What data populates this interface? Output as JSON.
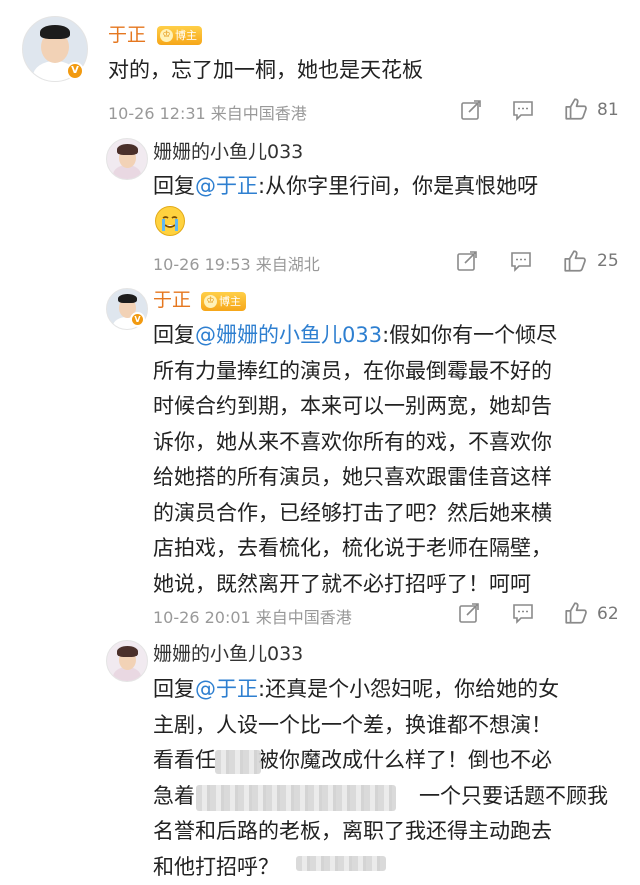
{
  "comments": [
    {
      "user": "于正",
      "badge": "博主",
      "lines": [
        "对的，忘了加一桐，她也是天花板"
      ],
      "meta": "10-26 12:31 来自中国香港",
      "likes": "81"
    },
    {
      "user": "姗姗的小鱼儿033",
      "reply_prefix": "回复",
      "mention": "@于正",
      "line1_rest": ":从你字里行间，你是真恨她呀",
      "meta": "10-26 19:53 来自湖北",
      "likes": "25"
    },
    {
      "user": "于正",
      "badge": "博主",
      "reply_prefix": "回复",
      "mention": "@姗姗的小鱼儿033",
      "line1_rest": ":假如你有一个倾尽",
      "lines": [
        "所有力量捧红的演员，在你最倒霉最不好的",
        "时候合约到期，本来可以一别两宽，她却告",
        "诉你，她从来不喜欢你所有的戏，不喜欢你",
        "给她搭的所有演员，她只喜欢跟雷佳音这样",
        "的演员合作，已经够打击了吧？然后她来横",
        "店拍戏，去看梳化，梳化说于老师在隔壁，",
        "她说，既然离开了就不必打招呼了！呵呵"
      ],
      "meta": "10-26 20:01 来自中国香港",
      "likes": "62"
    },
    {
      "user": "姗姗的小鱼儿033",
      "reply_prefix": "回复",
      "mention": "@于正",
      "line1_rest": ":还真是个小怨妇呢，你给她的女",
      "lines": [
        "主剧，人设一个比一个差，换谁都不想演！",
        "看看任",
        "急着",
        "名誉和后路的老板，离职了我还得主动跑去",
        "和他打招呼？"
      ],
      "fragments": {
        "line3_tail": "被你魔改成什么样了！倒也不必",
        "line4_tail": "一个只要话题不顾我"
      }
    }
  ],
  "icons": {
    "share": "share-icon",
    "comment": "comment-icon",
    "like": "like-icon"
  },
  "colors": {
    "username": "#e5771f",
    "mention": "#2e7fd0",
    "meta": "#999999",
    "badge": "#f6a619"
  }
}
